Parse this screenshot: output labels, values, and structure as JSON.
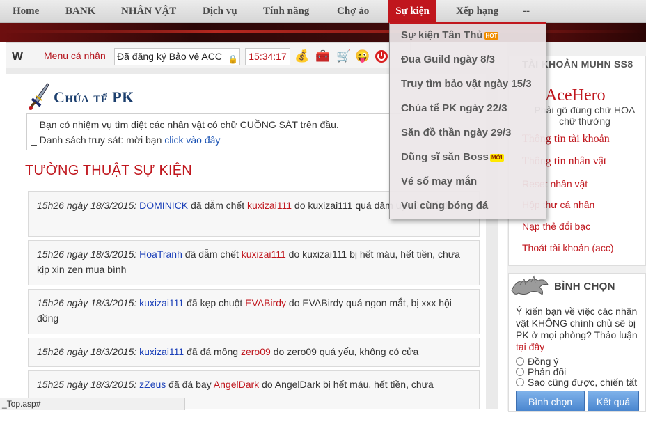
{
  "nav": {
    "items": [
      "Home",
      "BANK",
      "NHÂN VẬT",
      "Dịch vụ",
      "Tính năng",
      "Chợ ảo",
      "Sự kiện",
      "Xếp hạng",
      "--"
    ],
    "active_index": 6
  },
  "event_menu": {
    "items": [
      {
        "label": "Sự kiện Tân Thủ",
        "badge": "HOT"
      },
      {
        "label": "Đua Guild ngày 8/3",
        "badge": ""
      },
      {
        "label": "Truy tìm bảo vật ngày 15/3",
        "badge": ""
      },
      {
        "label": "Chúa tể PK ngày 22/3",
        "badge": ""
      },
      {
        "label": "Săn đồ thần ngày 29/3",
        "badge": ""
      },
      {
        "label": "Dũng sĩ săn Boss",
        "badge": "MỚI"
      },
      {
        "label": "Vé số may mắn",
        "badge": ""
      },
      {
        "label": "Vui cùng bóng đá",
        "badge": ""
      }
    ]
  },
  "toolbar": {
    "logo": "W",
    "menu_label": "Menu cá nhân",
    "status_text": "Đã đăng ký Bảo vệ ACC",
    "clock": "15:34:17",
    "icons": [
      "money-bag-icon",
      "treasure-chest-icon",
      "shopping-cart-icon",
      "smiley-icon",
      "power-icon"
    ]
  },
  "pk_box": {
    "title": "Chúa tể PK",
    "line1": "_ Bạn có nhiệm vụ tìm diệt các nhân vật có chữ CUỒNG SÁT trên đầu.",
    "line2_prefix": "_ Danh sách truy sát: mời bạn ",
    "line2_link": "click vào đây"
  },
  "report": {
    "title": "TƯỜNG THUẬT SỰ KIỆN",
    "entries": [
      {
        "time": "15h26 ngày 18/3/2015:",
        "p1": "DOMINICK",
        "verb": " đã dẫm chết ",
        "p2": "kuxizai111",
        "rest": " do kuxizai111 quá dâm uy của đối thủ"
      },
      {
        "time": "15h26 ngày 18/3/2015:",
        "p1": "HoaTranh",
        "verb": " đã dẫm chết ",
        "p2": "kuxizai111",
        "rest": " do kuxizai111 bị hết máu, hết tiền, chưa kịp xin zen mua bình"
      },
      {
        "time": "15h26 ngày 18/3/2015:",
        "p1": "kuxizai111",
        "verb": " đã kẹp chuột ",
        "p2": "EVABirdy",
        "rest": " do EVABirdy quá ngon mắt, bị xxx hội đồng"
      },
      {
        "time": "15h26 ngày 18/3/2015:",
        "p1": "kuxizai111",
        "verb": " đã đá mông ",
        "p2": "zero09",
        "rest": " do zero09 quá yếu, không có cửa"
      },
      {
        "time": "15h25 ngày 18/3/2015:",
        "p1": "zZeus",
        "verb": " đã đá bay ",
        "p2": "AngelDark",
        "rest": " do AngelDark bị hết máu, hết tiền, chưa"
      }
    ]
  },
  "account": {
    "header": "TÀI KHOẢN MUHN SS8",
    "username": "AceHero",
    "hint": "Phải gõ đúng chữ HOA chữ thường",
    "links": [
      "Thông tin tài khoản",
      "Thông tin nhân vật",
      "Reset nhân vật",
      "Hộp thư cá nhân",
      "Nạp thẻ đổi bạc",
      "Thoát tài khoản (acc)"
    ]
  },
  "vote": {
    "header": "BÌNH CHỌN",
    "question": "Ý kiến bạn về việc các nhân vật KHÔNG chính chủ sẽ bị PK ở mọi phòng? Thảo luận ",
    "question_link": "tại đây",
    "options": [
      "Đồng ý",
      "Phản đối",
      "Sao cũng được, chiến tất"
    ],
    "submit_label": "Bình chọn",
    "results_label": "Kết quả"
  },
  "statusbar": {
    "text": "_Top.asp#"
  },
  "colors": {
    "accent": "#c0161d",
    "link_blue": "#1a52b3",
    "title_blue": "#1c3f6e"
  }
}
